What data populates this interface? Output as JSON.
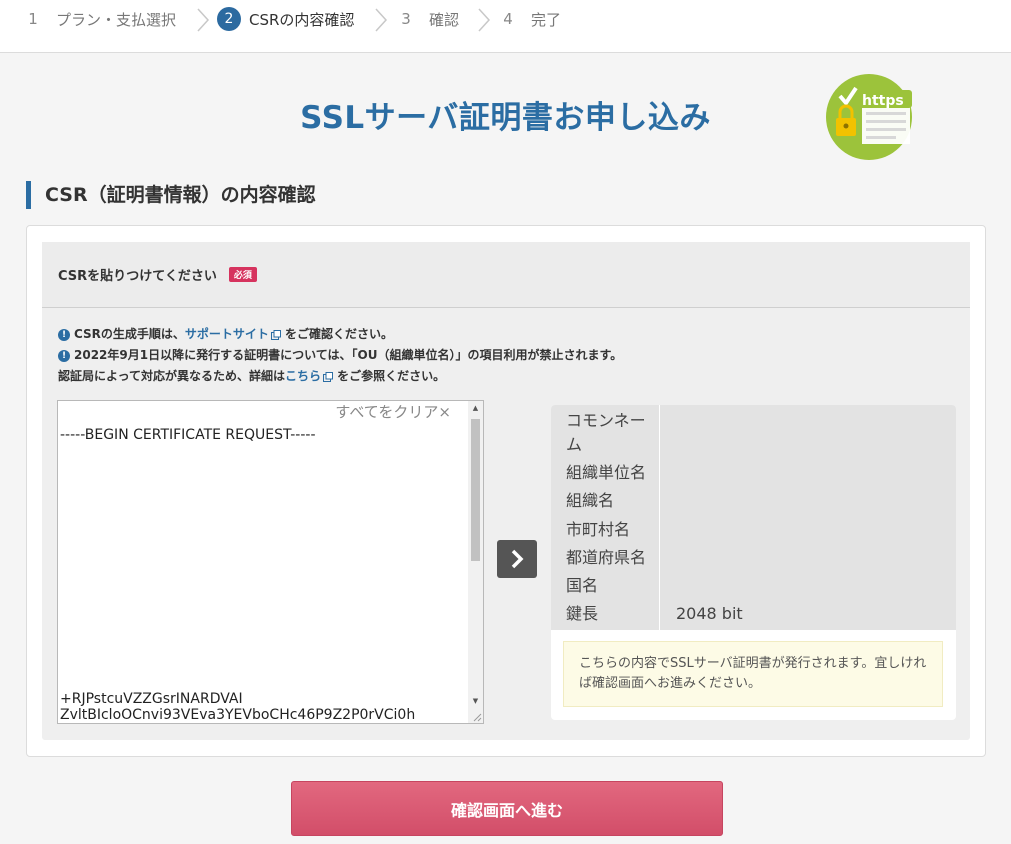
{
  "stepper": {
    "steps": [
      {
        "num": "1",
        "label": "プラン・支払選択"
      },
      {
        "num": "2",
        "label": "CSRの内容確認"
      },
      {
        "num": "3",
        "label": "確認"
      },
      {
        "num": "4",
        "label": "完了"
      }
    ]
  },
  "page": {
    "title": "SSLサーバ証明書お申し込み",
    "badge_text": "https"
  },
  "section": {
    "heading": "CSR（証明書情報）の内容確認"
  },
  "form": {
    "label": "CSRを貼りつけてください",
    "required": "必須",
    "notes": {
      "line1_pre": "CSRの生成手順は、",
      "line1_link": "サポートサイト",
      "line1_post": "をご確認ください。",
      "line2": "2022年9月1日以降に発行する証明書については、「OU（組織単位名）」の項目利用が禁止されます。",
      "line3_pre": "認証局によって対応が異なるため、詳細は",
      "line3_link": "こちら",
      "line3_post": "をご参照ください。"
    },
    "clear_all": "すべてをクリア×",
    "csr_first_line": "-----BEGIN CERTIFICATE REQUEST-----",
    "csr_line_a": "+RJPstcuVZZGsrINARDVAI",
    "csr_line_b": "ZvltBIcloOCnvi93VEva3YEVboCHc46P9Z2P0rVCi0h"
  },
  "result": {
    "rows": [
      {
        "key": "コモンネーム",
        "value": ""
      },
      {
        "key": "組織単位名",
        "value": ""
      },
      {
        "key": "組織名",
        "value": ""
      },
      {
        "key": "市町村名",
        "value": ""
      },
      {
        "key": "都道府県名",
        "value": ""
      },
      {
        "key": "国名",
        "value": ""
      },
      {
        "key": "鍵長",
        "value": "2048 bit"
      }
    ],
    "notice": "こちらの内容でSSLサーバ証明書が発行されます。宜しければ確認画面へお進みください。"
  },
  "submit": {
    "label": "確認画面へ進む"
  },
  "colors": {
    "brand": "#2b6da3",
    "required": "#d6335e",
    "submit": "#d9576f",
    "badge_green": "#9cc33b"
  }
}
